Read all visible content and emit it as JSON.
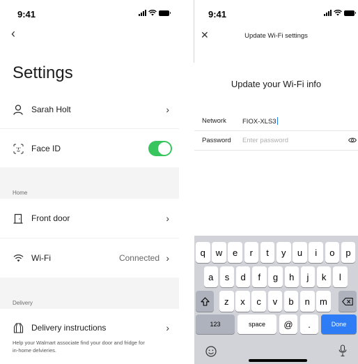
{
  "left_screen": {
    "status_time": "9:41",
    "title": "Settings",
    "rows": {
      "profile": {
        "label": "Sarah Holt",
        "icon": "person-icon"
      },
      "face_id": {
        "label": "Face ID",
        "icon": "face-id-icon",
        "toggle_on": true
      },
      "front_door": {
        "label": "Front door",
        "icon": "door-icon"
      },
      "wifi": {
        "label": "Wi-Fi",
        "icon": "wifi-icon",
        "status": "Connected"
      },
      "delivery": {
        "label": "Delivery instructions",
        "icon": "box-icon",
        "description": "Help your Walmart associate find your door and fridge for in-home delvieries."
      }
    },
    "sections": {
      "home": "Home",
      "delivery": "Delivery"
    },
    "colors": {
      "toggle_on": "#39c55d",
      "section_bg": "#f4f4f5"
    }
  },
  "right_screen": {
    "status_time": "9:41",
    "nav_title": "Update Wi-Fi settings",
    "heading": "Update your Wi-Fi info",
    "fields": {
      "network": {
        "label": "Network",
        "value": "FIOX-XLS3"
      },
      "password": {
        "label": "Password",
        "placeholder": "Enter password"
      }
    },
    "keyboard": {
      "row1": [
        "q",
        "w",
        "e",
        "r",
        "t",
        "y",
        "u",
        "i",
        "o",
        "p"
      ],
      "row2": [
        "a",
        "s",
        "d",
        "f",
        "g",
        "h",
        "j",
        "k",
        "l"
      ],
      "row3": [
        "z",
        "x",
        "c",
        "v",
        "b",
        "n",
        "m"
      ],
      "numbers_key": "123",
      "space_key": "space",
      "at_key": "@",
      "dot_key": ".",
      "done_key": "Done"
    },
    "colors": {
      "done_key": "#2e7cf6",
      "caret": "#1c7cf0",
      "keyboard_bg": "#d1d3d9"
    }
  }
}
